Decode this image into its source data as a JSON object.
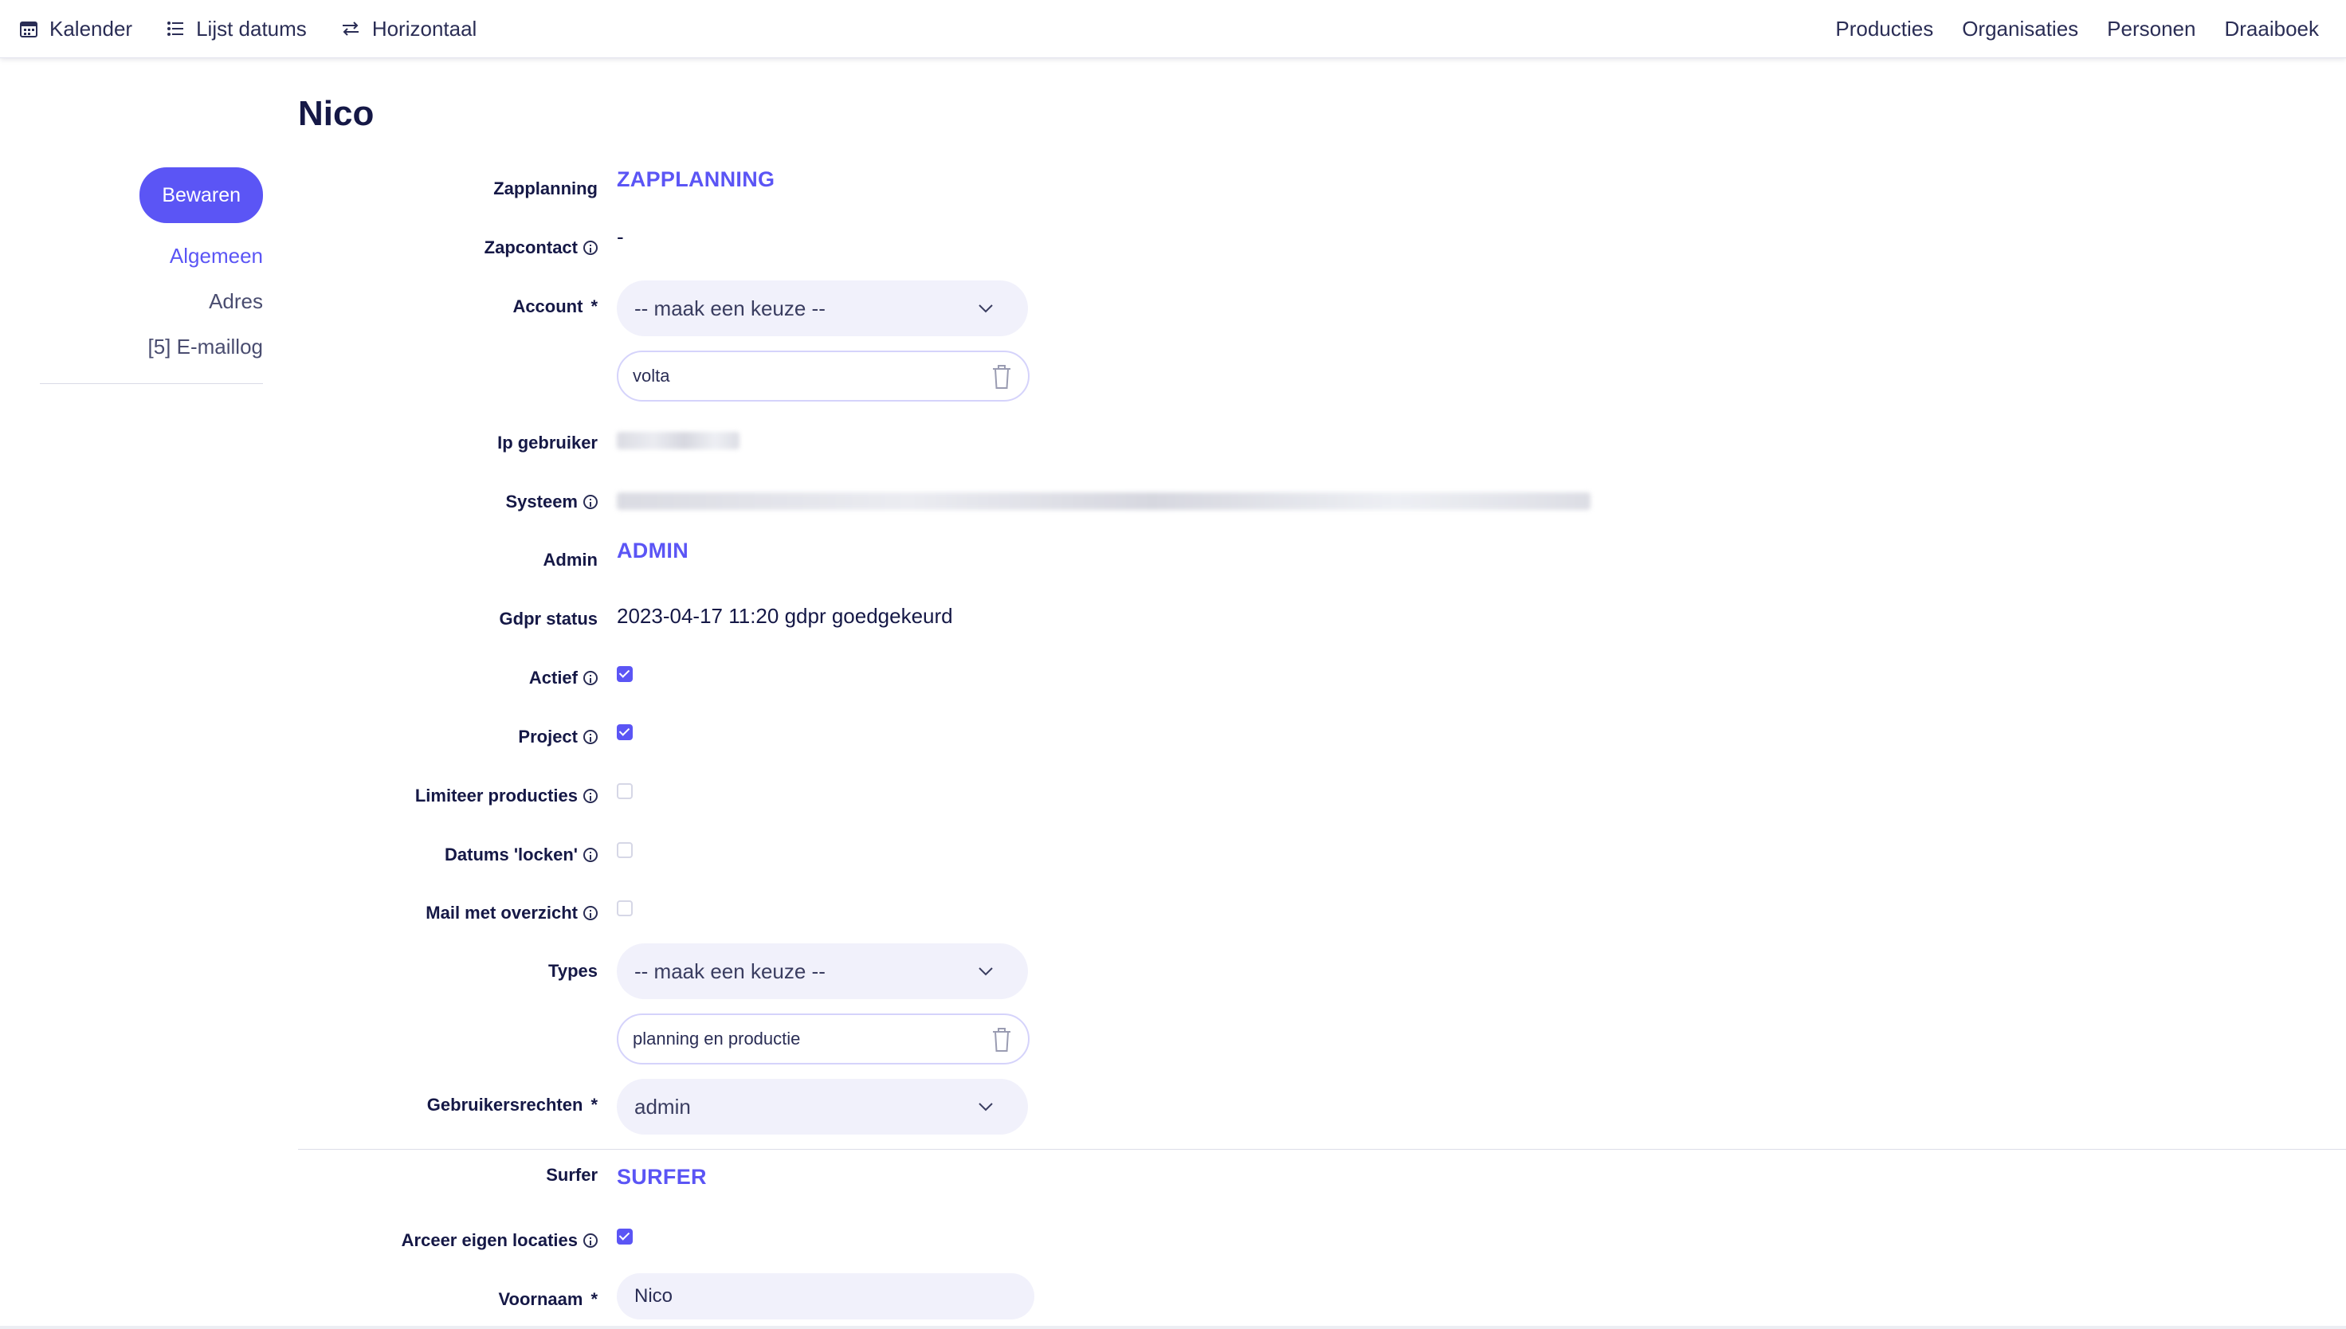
{
  "topnav": {
    "left": [
      {
        "label": "Kalender",
        "icon": "calendar-icon"
      },
      {
        "label": "Lijst datums",
        "icon": "list-icon"
      },
      {
        "label": "Horizontaal",
        "icon": "arrows-horizontal-icon"
      }
    ],
    "right": [
      "Producties",
      "Organisaties",
      "Personen",
      "Draaiboek"
    ]
  },
  "page": {
    "title": "Nico"
  },
  "sidebar": {
    "save_label": "Bewaren",
    "links": [
      "Algemeen",
      "Adres",
      "[5] E-maillog"
    ]
  },
  "form": {
    "zapplanning": {
      "label": "Zapplanning",
      "value": "ZAPPLANNING"
    },
    "zapcontact": {
      "label": "Zapcontact",
      "value": "-"
    },
    "account": {
      "label": "Account",
      "required": "*",
      "select": "-- maak een keuze --",
      "tag": "volta"
    },
    "ip": {
      "label": "Ip gebruiker"
    },
    "systeem": {
      "label": "Systeem"
    },
    "admin": {
      "label": "Admin",
      "value": "ADMIN"
    },
    "gdpr": {
      "label": "Gdpr status",
      "value": "2023-04-17 11:20 gdpr goedgekeurd"
    },
    "actief": {
      "label": "Actief",
      "checked": true
    },
    "project": {
      "label": "Project",
      "checked": true
    },
    "limiteer": {
      "label": "Limiteer producties",
      "checked": false
    },
    "datums": {
      "label": "Datums 'locken'",
      "checked": false
    },
    "mail": {
      "label": "Mail met overzicht",
      "checked": false
    },
    "types": {
      "label": "Types",
      "select": "-- maak een keuze --",
      "tag": "planning en productie"
    },
    "rechten": {
      "label": "Gebruikersrechten",
      "required": "*",
      "select": "admin"
    },
    "surfer": {
      "label": "Surfer",
      "value": "SURFER"
    },
    "arceer": {
      "label": "Arceer eigen locaties",
      "checked": true
    },
    "voornaam": {
      "label": "Voornaam",
      "required": "*",
      "value": "Nico"
    }
  },
  "colors": {
    "accent": "#5b55f5",
    "text": "#151846",
    "field_bg": "#f1f1fb"
  }
}
